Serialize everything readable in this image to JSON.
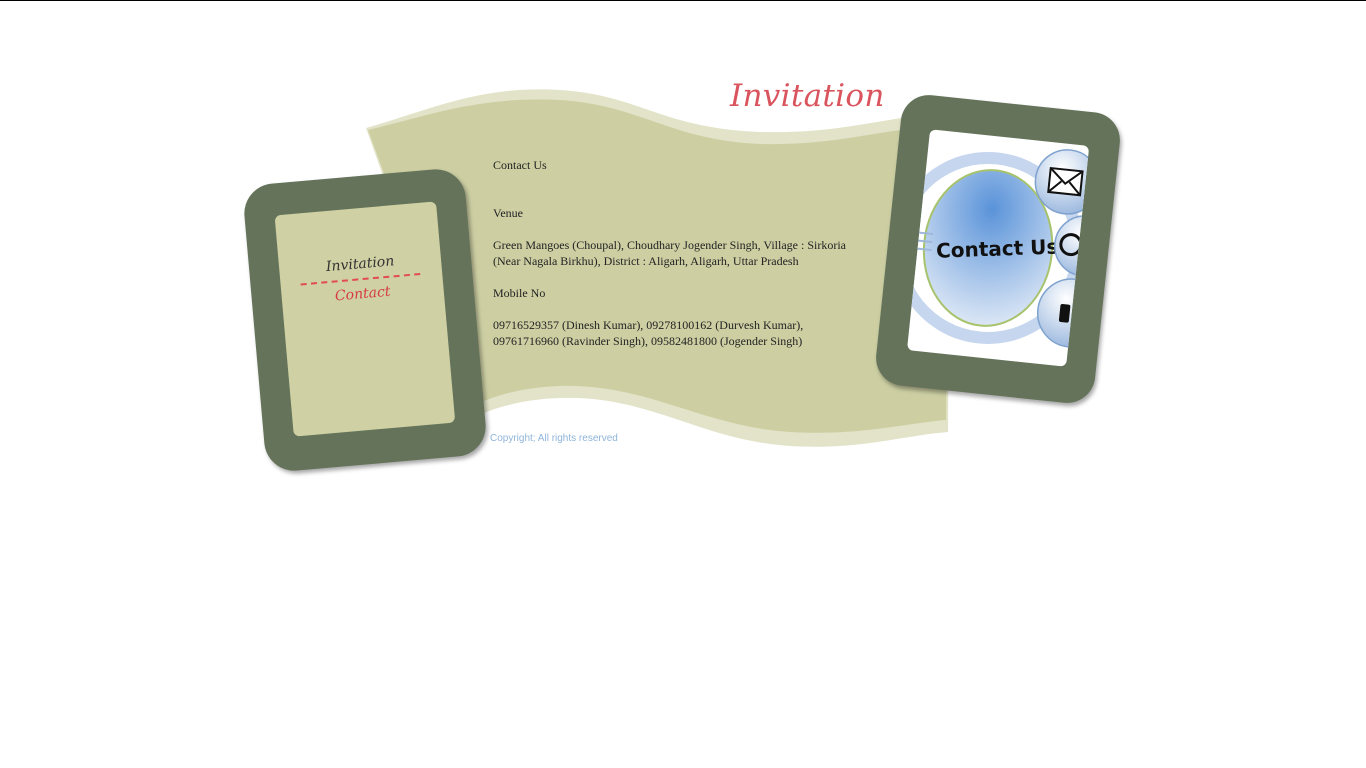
{
  "header": {
    "title": "Invitation"
  },
  "nav": {
    "items": [
      {
        "label": "Invitation"
      },
      {
        "label": "Contact"
      }
    ]
  },
  "content": {
    "heading": "Contact Us",
    "venue_label": "Venue",
    "venue_address_line1": "Green Mangoes (Choupal), Choudhary Jogender Singh, Village : Sirkoria",
    "venue_address_line2": "(Near Nagala Birkhu), District : Aligarh, Aligarh, Uttar Pradesh",
    "mobile_label": "Mobile No",
    "mobile_numbers_line1": "09716529357 (Dinesh Kumar), 09278100162 (Durvesh Kumar),",
    "mobile_numbers_line2": "09761716960 (Ravinder Singh), 09582481800 (Jogender Singh)"
  },
  "contact_graphic": {
    "text": "Contact Us",
    "icons": [
      "envelope-icon",
      "phone-icon",
      "mobile-icon"
    ]
  },
  "footer": {
    "copyright": "Copyright;  All rights reserved"
  },
  "colors": {
    "banner": "#cdcfa3",
    "banner_edge": "#e2e3c8",
    "phone_frame": "#64735a",
    "title": "#d9545d",
    "nav_active": "#d63b45",
    "footer_text": "#8fb4d9"
  }
}
